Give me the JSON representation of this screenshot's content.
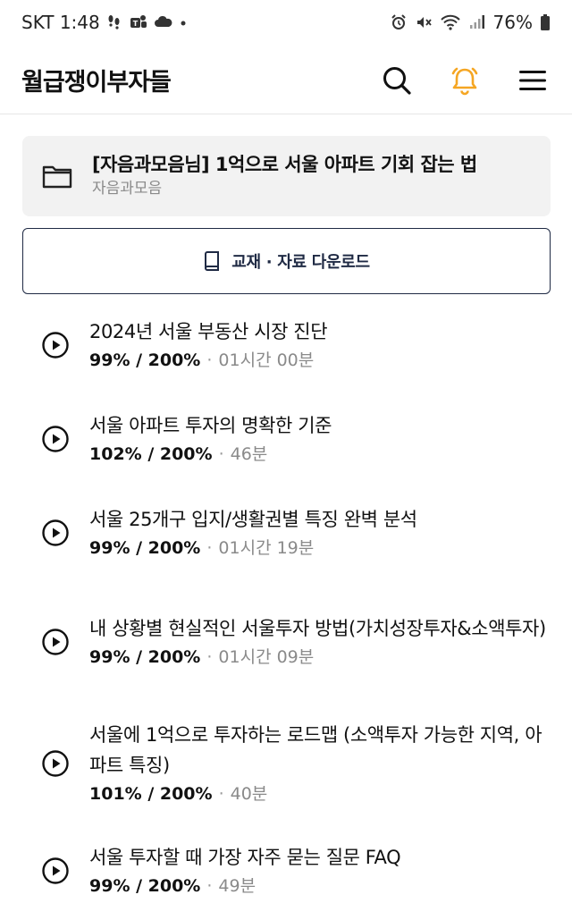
{
  "status_bar": {
    "carrier_time": "SKT 1:48",
    "battery": "76%"
  },
  "header": {
    "brand": "월급쟁이부자들",
    "icons": [
      "search-icon",
      "bell-icon",
      "menu-icon"
    ],
    "accent_color": "#f5a623"
  },
  "course": {
    "title": "[자음과모음님] 1억으로 서울 아파트 기회 잡는 법",
    "author": "자음과모음"
  },
  "download": {
    "label": "교재 · 자료 다운로드"
  },
  "lessons": [
    {
      "title": "2024년 서울 부동산 시장 진단",
      "progress": "99% / 200%",
      "duration": "01시간 00분"
    },
    {
      "title": "서울 아파트 투자의 명확한 기준",
      "progress": "102% / 200%",
      "duration": "46분"
    },
    {
      "title": "서울 25개구 입지/생활권별 특징 완벽 분석",
      "progress": "99% / 200%",
      "duration": "01시간 19분"
    },
    {
      "title": "내 상황별 현실적인 서울투자 방법(가치성장투자&소액투자)",
      "progress": "99% / 200%",
      "duration": "01시간 09분"
    },
    {
      "title": "서울에 1억으로 투자하는 로드맵 (소액투자 가능한 지역, 아파트 특징)",
      "progress": "101% / 200%",
      "duration": "40분"
    },
    {
      "title": "서울 투자할 때 가장 자주 묻는 질문 FAQ",
      "progress": "99% / 200%",
      "duration": "49분"
    }
  ]
}
